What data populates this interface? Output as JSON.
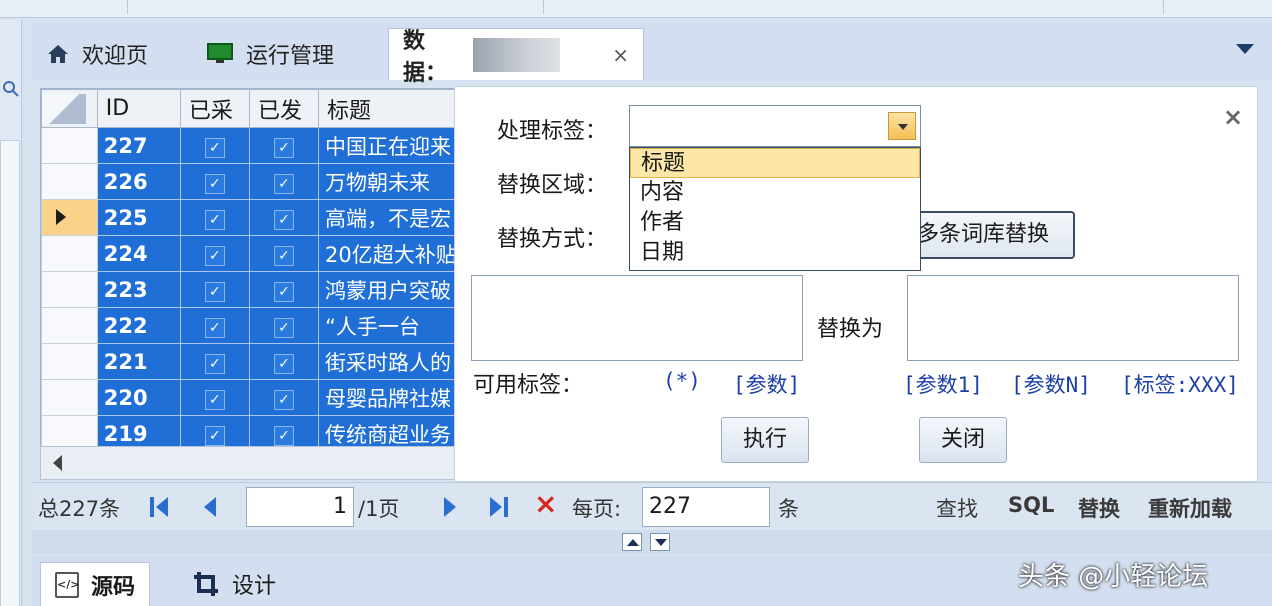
{
  "tabs": [
    {
      "label": "欢迎页",
      "icon": "home-icon"
    },
    {
      "label": "运行管理",
      "icon": "monitor-icon"
    },
    {
      "label": "数据：",
      "icon": "",
      "close": "×"
    }
  ],
  "grid": {
    "columns": [
      "ID",
      "已采",
      "已发",
      "标题"
    ],
    "rows": [
      {
        "id": "227",
        "title": "中国正在迎来"
      },
      {
        "id": "226",
        "title": "万物朝未来"
      },
      {
        "id": "225",
        "title": "高端，不是宏"
      },
      {
        "id": "224",
        "title": "20亿超大补贴"
      },
      {
        "id": "223",
        "title": "鸿蒙用户突破"
      },
      {
        "id": "222",
        "title": "“人手一台"
      },
      {
        "id": "221",
        "title": "街采时路人的"
      },
      {
        "id": "220",
        "title": "母婴品牌社媒"
      },
      {
        "id": "219",
        "title": "传统商超业务"
      }
    ],
    "check_mark": "✓"
  },
  "dialog": {
    "label_tag": "处理标签：",
    "label_area": "替换区域：",
    "label_method": "替换方式：",
    "dropdown_options": [
      "标题",
      "内容",
      "作者",
      "日期"
    ],
    "multi_replace_button": "多条词库替换",
    "replace_with": "替换为",
    "available_tags_label": "可用标签：",
    "tag_star": "(*)",
    "tag_param": "[参数]",
    "tag_param1": "[参数1]",
    "tag_paramN": "[参数N]",
    "tag_label": "[标签:XXX]",
    "execute_button": "执行",
    "close_button": "关闭",
    "close_x": "×"
  },
  "pager": {
    "total": "总227条",
    "page_value": "1",
    "page_total": "/1页",
    "per_page_label": "每页:",
    "per_page_value": "227",
    "unit": "条",
    "find": "查找",
    "sql": "SQL",
    "replace": "替换",
    "reload": "重新加载",
    "delete_icon": "×"
  },
  "bottom_tabs": [
    {
      "label": "源码",
      "icon": "code-file-icon"
    },
    {
      "label": "设计",
      "icon": "design-crop-icon"
    }
  ],
  "watermark": "头条 @小轻论坛",
  "colors": {
    "selection": "#1f6fd6",
    "highlight": "#fde7a6",
    "link": "#1d3fa8"
  }
}
